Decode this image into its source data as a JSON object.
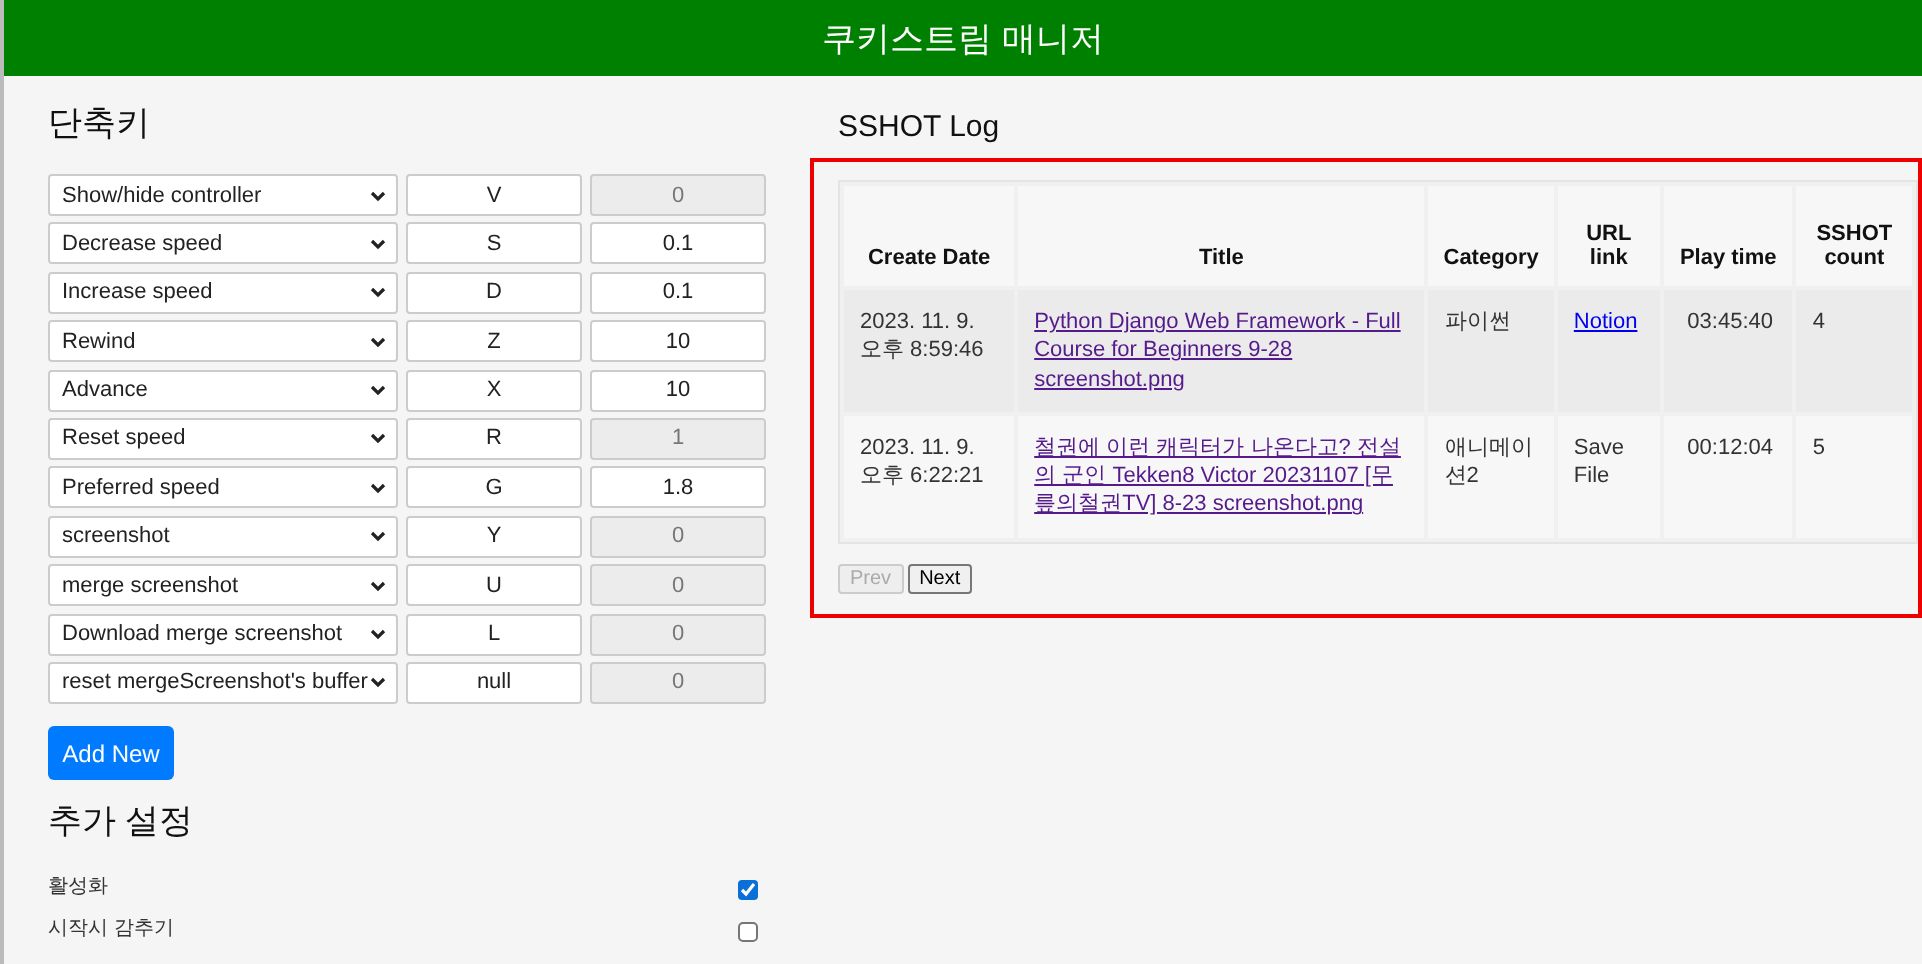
{
  "header": {
    "title": "쿠키스트림 매니저"
  },
  "shortcuts": {
    "title": "단축키",
    "add_button": "Add New",
    "rows": [
      {
        "action": "Show/hide controller",
        "key": "V",
        "value": "0",
        "disabled": true
      },
      {
        "action": "Decrease speed",
        "key": "S",
        "value": "0.1",
        "disabled": false
      },
      {
        "action": "Increase speed",
        "key": "D",
        "value": "0.1",
        "disabled": false
      },
      {
        "action": "Rewind",
        "key": "Z",
        "value": "10",
        "disabled": false
      },
      {
        "action": "Advance",
        "key": "X",
        "value": "10",
        "disabled": false
      },
      {
        "action": "Reset speed",
        "key": "R",
        "value": "1",
        "disabled": true
      },
      {
        "action": "Preferred speed",
        "key": "G",
        "value": "1.8",
        "disabled": false
      },
      {
        "action": "screenshot",
        "key": "Y",
        "value": "0",
        "disabled": true
      },
      {
        "action": "merge screenshot",
        "key": "U",
        "value": "0",
        "disabled": true
      },
      {
        "action": "Download merge screenshot",
        "key": "L",
        "value": "0",
        "disabled": true
      },
      {
        "action": "reset mergeScreenshot's buffer",
        "key": "null",
        "value": "0",
        "disabled": true
      }
    ]
  },
  "settings": {
    "title": "추가 설정",
    "items": [
      {
        "label": "활성화",
        "checked": true
      },
      {
        "label": "시작시 감추기",
        "checked": false
      }
    ]
  },
  "log": {
    "title": "SSHOT Log",
    "columns": [
      "Create Date",
      "Title",
      "Category",
      "URL link",
      "Play time",
      "SSHOT count"
    ],
    "rows": [
      {
        "create_date": "2023. 11. 9. 오후 8:59:46",
        "title": "Python Django Web Framework - Full Course for Beginners 9-28 screenshot.png",
        "category": "파이썬",
        "url_link": {
          "kind": "link",
          "text": "Notion"
        },
        "play_time": "03:45:40",
        "sshot_count": "4",
        "selected": true
      },
      {
        "create_date": "2023. 11. 9. 오후 6:22:21",
        "title": "철권에 이런 캐릭터가 나온다고? 전설의 군인 Tekken8 Victor 20231107 [무릎의철권TV] 8-23 screenshot.png",
        "category": "애니메이션2",
        "url_link": {
          "kind": "text",
          "text": "Save File"
        },
        "play_time": "00:12:04",
        "sshot_count": "5",
        "selected": false
      }
    ],
    "prev": {
      "label": "Prev",
      "disabled": true
    },
    "next": {
      "label": "Next",
      "disabled": false
    }
  }
}
